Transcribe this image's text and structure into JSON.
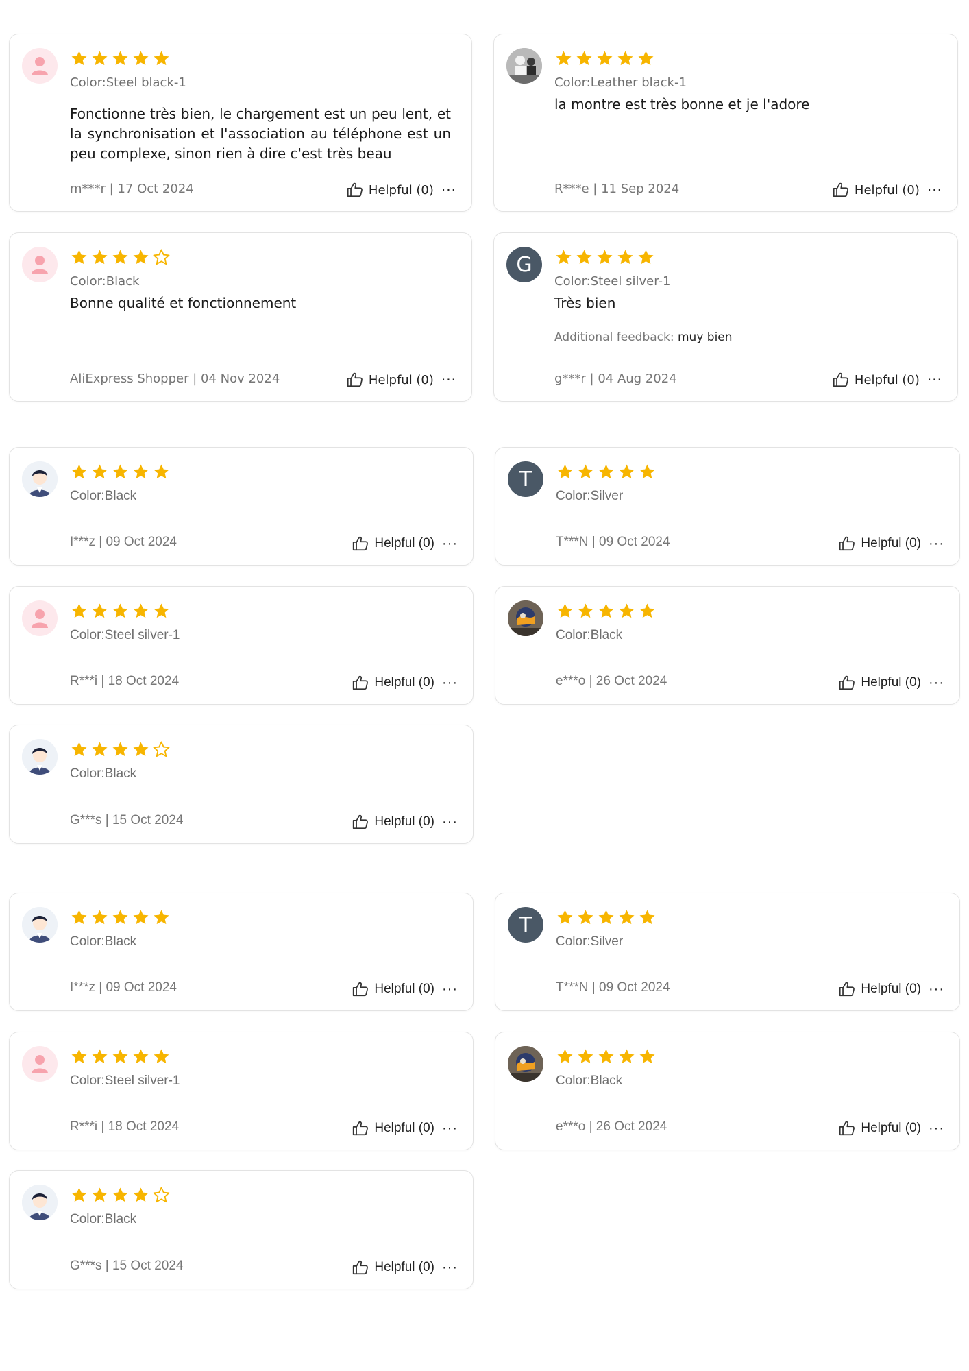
{
  "helpful_label": "Helpful (0)",
  "more_label": "···",
  "star_color": "#f7b500",
  "reviews": [
    {
      "avatar": "pink-user-icon",
      "rating": 5,
      "color": "Color:Steel black-1",
      "text": "Fonctionne très bien, le chargement est un peu lent, et la synchronisation et l'association au téléphone est un peu complexe, sinon rien à dire c'est très beau",
      "meta": "m***r | 17 Oct 2024"
    },
    {
      "avatar": "photo-avatar",
      "rating": 5,
      "color": "Color:Leather black-1",
      "text": "la montre est très bonne et je l'adore",
      "meta": "R***e | 11 Sep 2024"
    },
    {
      "avatar": "pink-user-icon",
      "rating": 4,
      "color": "Color:Black",
      "text": "Bonne qualité et fonctionnement",
      "meta": "AliExpress Shopper | 04 Nov 2024"
    },
    {
      "avatar": "letter-avatar",
      "letter": "G",
      "rating": 5,
      "color": "Color:Steel silver-1",
      "text": "Très bien",
      "extra_label": "Additional feedback:",
      "extra_value": "muy bien",
      "meta": "g***r | 04 Aug 2024"
    },
    {
      "avatar": "cartoon-avatar",
      "rating": 5,
      "color": "Color:Black",
      "meta": "I***z | 09 Oct 2024"
    },
    {
      "avatar": "letter-avatar",
      "letter": "T",
      "rating": 5,
      "color": "Color:Silver",
      "meta": "T***N | 09 Oct 2024"
    },
    {
      "avatar": "pink-user-icon",
      "rating": 5,
      "color": "Color:Steel silver-1",
      "meta": "R***i | 18 Oct 2024"
    },
    {
      "avatar": "photo-avatar",
      "rating": 5,
      "color": "Color:Black",
      "meta": "e***o | 26 Oct 2024"
    },
    {
      "avatar": "cartoon-avatar",
      "rating": 4,
      "color": "Color:Black",
      "meta": "G***s | 15 Oct 2024"
    },
    {
      "avatar": "cartoon-avatar",
      "rating": 5,
      "color": "Color:Black",
      "meta": "I***z | 09 Oct 2024"
    },
    {
      "avatar": "letter-avatar",
      "letter": "T",
      "rating": 5,
      "color": "Color:Silver",
      "meta": "T***N | 09 Oct 2024"
    },
    {
      "avatar": "pink-user-icon",
      "rating": 5,
      "color": "Color:Steel silver-1",
      "meta": "R***i | 18 Oct 2024"
    },
    {
      "avatar": "photo-avatar",
      "rating": 5,
      "color": "Color:Black",
      "meta": "e***o | 26 Oct 2024"
    },
    {
      "avatar": "cartoon-avatar",
      "rating": 4,
      "color": "Color:Black",
      "meta": "G***s | 15 Oct 2024"
    }
  ]
}
